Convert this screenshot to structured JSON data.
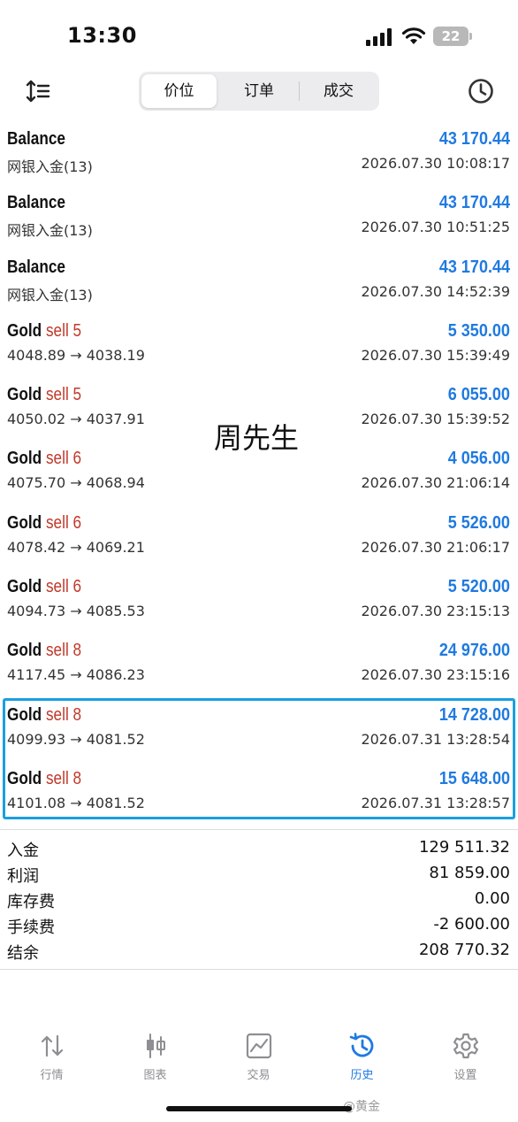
{
  "status_bar": {
    "time": "13:30",
    "battery": "22"
  },
  "toolbar": {
    "tabs": [
      {
        "label": "价位",
        "active": true
      },
      {
        "label": "订单",
        "active": false
      },
      {
        "label": "成交",
        "active": false
      }
    ],
    "left_icon": "sort-icon",
    "right_icon": "history-clock-icon"
  },
  "deals": [
    {
      "symbol": "Balance",
      "type": "",
      "volume": "",
      "amount": "43 170.44",
      "detail": "网银入金(13)",
      "time": "2026.07.30 10:08:17"
    },
    {
      "symbol": "Balance",
      "type": "",
      "volume": "",
      "amount": "43 170.44",
      "detail": "网银入金(13)",
      "time": "2026.07.30 10:51:25"
    },
    {
      "symbol": "Balance",
      "type": "",
      "volume": "",
      "amount": "43 170.44",
      "detail": "网银入金(13)",
      "time": "2026.07.30 14:52:39"
    },
    {
      "symbol": "Gold",
      "type": "sell",
      "volume": "5",
      "amount": "5 350.00",
      "detail": "4048.89 → 4038.19",
      "time": "2026.07.30 15:39:49"
    },
    {
      "symbol": "Gold",
      "type": "sell",
      "volume": "5",
      "amount": "6 055.00",
      "detail": "4050.02 → 4037.91",
      "time": "2026.07.30 15:39:52"
    },
    {
      "symbol": "Gold",
      "type": "sell",
      "volume": "6",
      "amount": "4 056.00",
      "detail": "4075.70 → 4068.94",
      "time": "2026.07.30 21:06:14"
    },
    {
      "symbol": "Gold",
      "type": "sell",
      "volume": "6",
      "amount": "5 526.00",
      "detail": "4078.42 → 4069.21",
      "time": "2026.07.30 21:06:17"
    },
    {
      "symbol": "Gold",
      "type": "sell",
      "volume": "6",
      "amount": "5 520.00",
      "detail": "4094.73 → 4085.53",
      "time": "2026.07.30 23:15:13"
    },
    {
      "symbol": "Gold",
      "type": "sell",
      "volume": "8",
      "amount": "24 976.00",
      "detail": "4117.45 → 4086.23",
      "time": "2026.07.30 23:15:16"
    },
    {
      "symbol": "Gold",
      "type": "sell",
      "volume": "8",
      "amount": "14 728.00",
      "detail": "4099.93 → 4081.52",
      "time": "2026.07.31 13:28:54"
    },
    {
      "symbol": "Gold",
      "type": "sell",
      "volume": "8",
      "amount": "15 648.00",
      "detail": "4101.08 → 4081.52",
      "time": "2026.07.31 13:28:57"
    }
  ],
  "watermark_text": "周先生",
  "summary": [
    {
      "label": "入金",
      "value": "129 511.32"
    },
    {
      "label": "利润",
      "value": "81 859.00"
    },
    {
      "label": "库存费",
      "value": "0.00"
    },
    {
      "label": "手续费",
      "value": "-2 600.00"
    },
    {
      "label": "结余",
      "value": "208 770.32"
    }
  ],
  "tabbar": [
    {
      "label": "行情",
      "icon": "quotes-icon",
      "active": false
    },
    {
      "label": "图表",
      "icon": "chart-icon",
      "active": false
    },
    {
      "label": "交易",
      "icon": "trade-icon",
      "active": false
    },
    {
      "label": "历史",
      "icon": "history-icon",
      "active": true
    },
    {
      "label": "设置",
      "icon": "settings-icon",
      "active": false
    }
  ],
  "weibo_mark": "@黄金",
  "colors": {
    "accent": "#1f7ae0",
    "sell": "#c0392b",
    "highlight": "#1a9fe0"
  }
}
